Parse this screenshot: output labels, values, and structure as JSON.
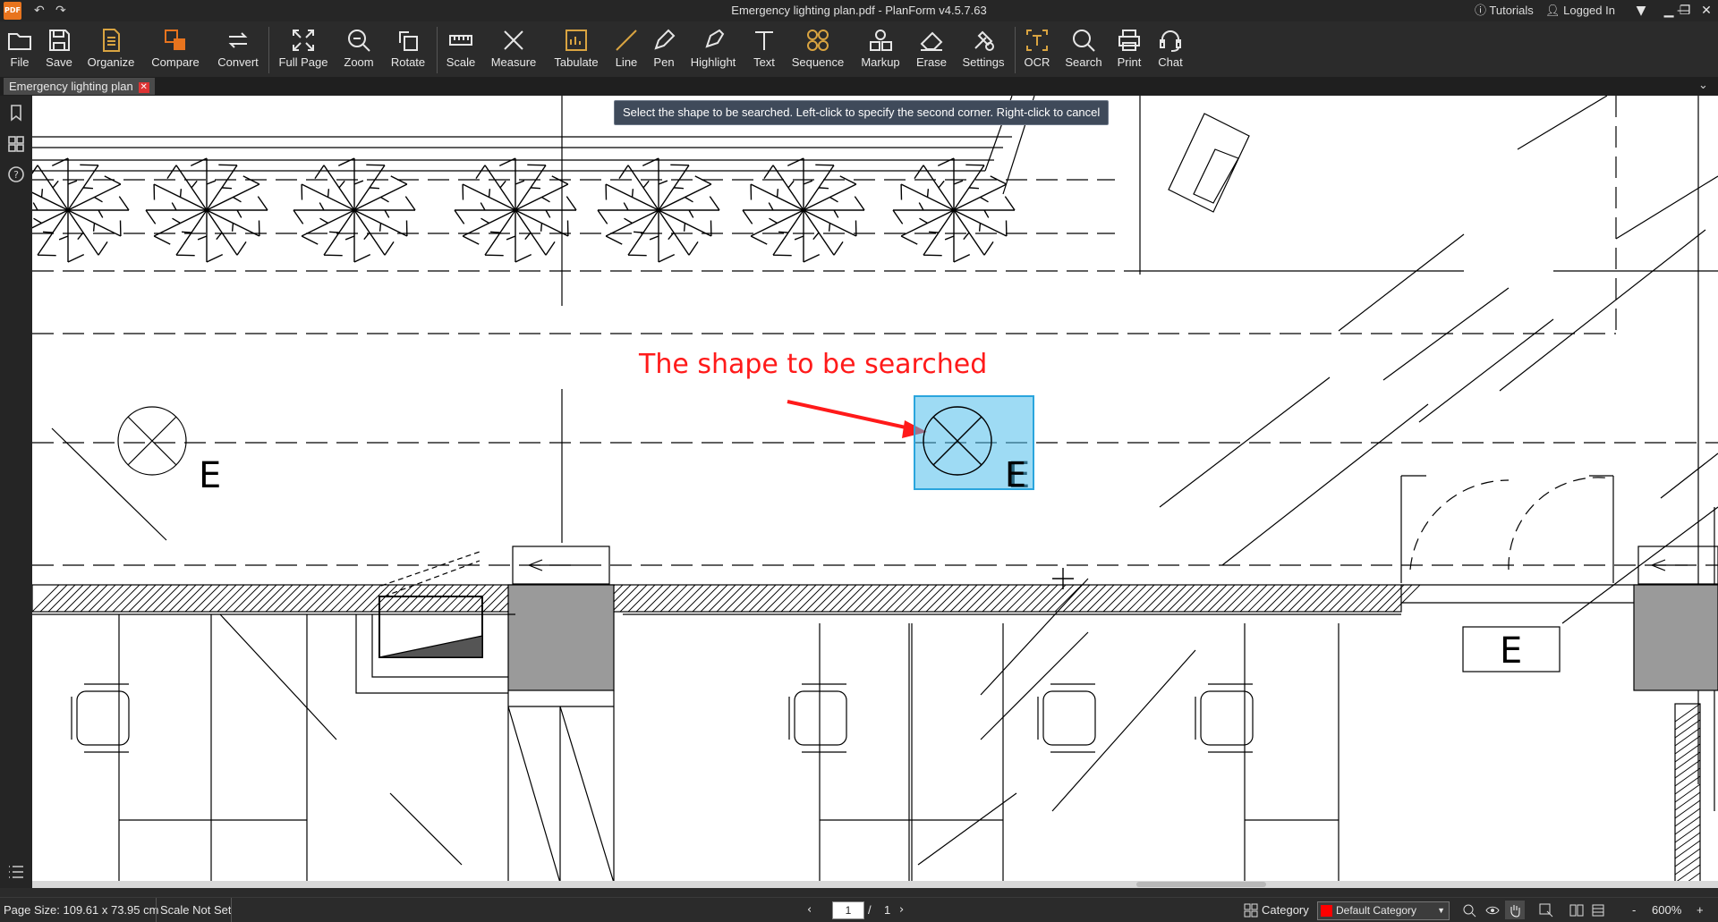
{
  "app": {
    "logo_text": "PDF",
    "window_title": "Emergency lighting plan.pdf - PlanForm v4.5.7.63",
    "undo_icon": "undo-icon",
    "redo_icon": "redo-icon",
    "tutorials_label": "Tutorials",
    "login_label": "Logged In"
  },
  "toolbar": {
    "items": [
      {
        "label": "File",
        "icon": "folder-icon"
      },
      {
        "label": "Save",
        "icon": "save-icon"
      },
      {
        "label": "Organize",
        "icon": "document-icon"
      },
      {
        "label": "Compare",
        "icon": "compare-icon"
      },
      {
        "label": "Convert",
        "icon": "convert-icon"
      },
      {
        "label": "Full Page",
        "icon": "expand-icon"
      },
      {
        "label": "Zoom",
        "icon": "zoom-icon"
      },
      {
        "label": "Rotate",
        "icon": "rotate-icon"
      },
      {
        "label": "Scale",
        "icon": "ruler-icon"
      },
      {
        "label": "Measure",
        "icon": "measure-icon"
      },
      {
        "label": "Tabulate",
        "icon": "tabulate-icon"
      },
      {
        "label": "Line",
        "icon": "line-icon"
      },
      {
        "label": "Pen",
        "icon": "pen-icon"
      },
      {
        "label": "Highlight",
        "icon": "highlighter-icon"
      },
      {
        "label": "Text",
        "icon": "text-icon"
      },
      {
        "label": "Sequence",
        "icon": "sequence-icon"
      },
      {
        "label": "Markup",
        "icon": "markup-icon"
      },
      {
        "label": "Erase",
        "icon": "eraser-icon"
      },
      {
        "label": "Settings",
        "icon": "settings-icon"
      },
      {
        "label": "OCR",
        "icon": "ocr-icon"
      },
      {
        "label": "Search",
        "icon": "search-icon"
      },
      {
        "label": "Print",
        "icon": "printer-icon"
      },
      {
        "label": "Chat",
        "icon": "headset-icon"
      }
    ]
  },
  "tabs": {
    "document_tab": "Emergency lighting plan",
    "close_glyph": "✕"
  },
  "canvas": {
    "hint_text": "Select the shape to be searched. Left-click to specify the second corner. Right-click to cancel",
    "annotation_text": "The shape to be searched",
    "symbol_letter": "E",
    "accent_color": "#ff1a1a",
    "selection_color": "#4fbeeb"
  },
  "statusbar": {
    "page_size": "Page Size: 109.61 x 73.95 cm",
    "scale_status": "Scale Not Set",
    "page_current": "1",
    "page_sep": "/",
    "page_total": "1",
    "category_label": "Category",
    "category_value": "Default Category",
    "zoom_value": "600%",
    "zoom_minus": "-",
    "zoom_plus": "+"
  }
}
